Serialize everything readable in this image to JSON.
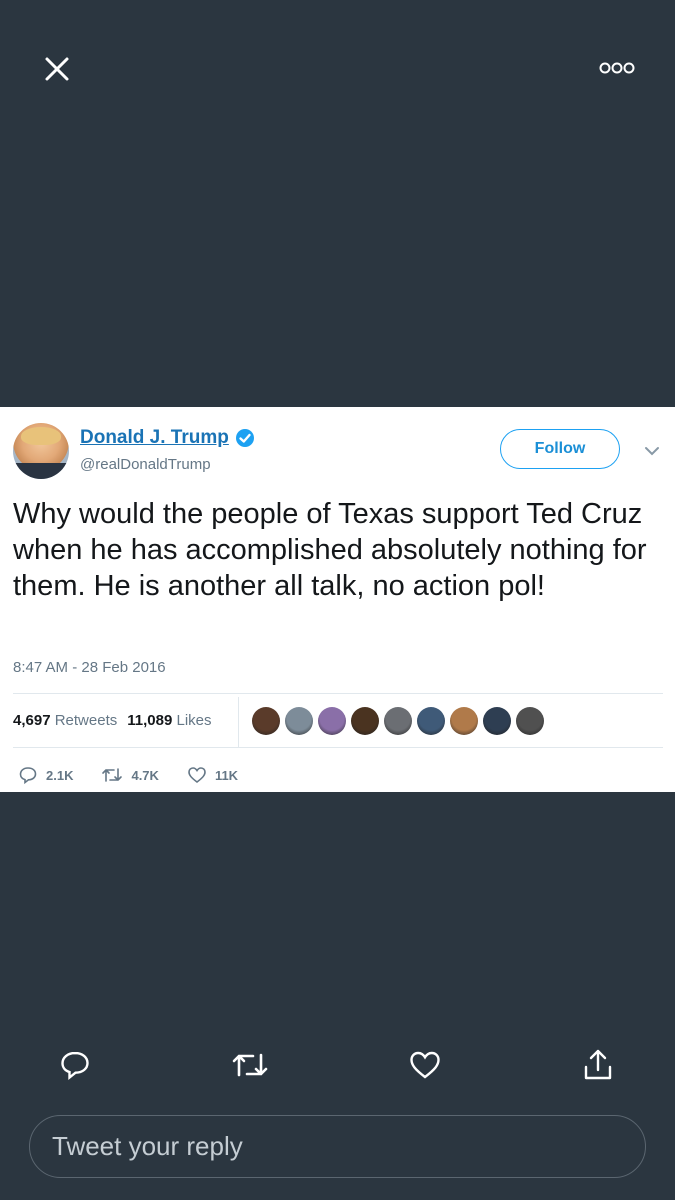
{
  "topbar": {
    "close_icon": "close-icon",
    "more_icon": "more-icon"
  },
  "tweet": {
    "display_name": "Donald J. Trump",
    "handle": "@realDonaldTrump",
    "follow_label": "Follow",
    "text": "Why would the people of Texas support Ted Cruz when he has accomplished absolutely nothing for them. He is another all talk, no action pol!",
    "timestamp": "8:47 AM - 28 Feb 2016",
    "retweets_count": "4,697",
    "retweets_label": "Retweets",
    "likes_count": "11,089",
    "likes_label": "Likes",
    "reply_count": "2.1K",
    "retweet_count_short": "4.7K",
    "like_count_short": "11K",
    "likers_colors": [
      "#5a3b2a",
      "#7d8c99",
      "#8a6fa8",
      "#4a3320",
      "#6b6e73",
      "#3f5a78",
      "#b07a4a",
      "#2e3e52",
      "#505050"
    ]
  },
  "bottom_bar": {
    "reply_icon": "reply-icon",
    "retweet_icon": "retweet-icon",
    "like_icon": "heart-icon",
    "share_icon": "share-icon",
    "reply_placeholder": "Tweet your reply"
  },
  "colors": {
    "background": "#2b3640",
    "link": "#1a73b5",
    "follow": "#1da1f2"
  }
}
